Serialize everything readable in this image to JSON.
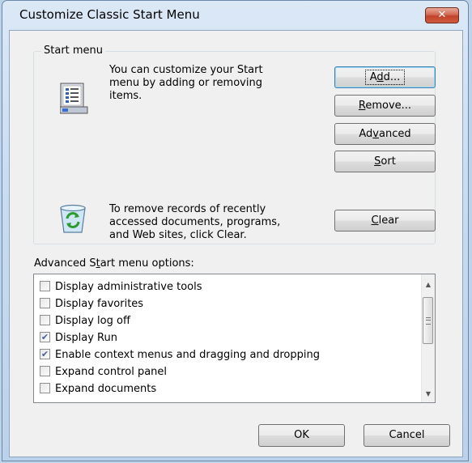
{
  "window": {
    "title": "Customize Classic Start Menu",
    "close_glyph": "✕"
  },
  "start_menu": {
    "group_label": "Start menu",
    "description_lines": [
      "You can customize your Start",
      "menu by adding or removing",
      "items."
    ],
    "clear_lines": [
      "To remove records of recently",
      "accessed documents, programs,",
      "and Web sites, click Clear."
    ],
    "buttons": {
      "add": {
        "pre": "A",
        "key": "d",
        "post": "d..."
      },
      "remove": {
        "pre": "",
        "key": "R",
        "post": "emove..."
      },
      "advanced": {
        "pre": "Ad",
        "key": "v",
        "post": "anced"
      },
      "sort": {
        "pre": "",
        "key": "S",
        "post": "ort"
      },
      "clear": {
        "pre": "",
        "key": "C",
        "post": "lear"
      }
    }
  },
  "advanced": {
    "label_pre": "Advanced S",
    "label_key": "t",
    "label_post": "art menu options:",
    "items": [
      {
        "label": "Display administrative tools",
        "checked": false
      },
      {
        "label": "Display favorites",
        "checked": false
      },
      {
        "label": "Display log off",
        "checked": false
      },
      {
        "label": "Display Run",
        "checked": true
      },
      {
        "label": "Enable context menus and dragging and dropping",
        "checked": true
      },
      {
        "label": "Expand control panel",
        "checked": false
      },
      {
        "label": "Expand documents",
        "checked": false
      }
    ]
  },
  "footer": {
    "ok": "OK",
    "cancel": "Cancel"
  },
  "icons": {
    "start_menu_icon": "start-menu-document-icon",
    "recycle_icon": "recycle-bin-icon"
  }
}
